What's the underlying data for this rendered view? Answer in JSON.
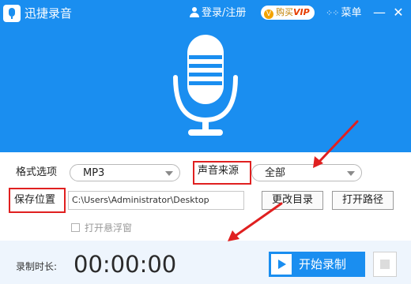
{
  "app": {
    "title": "迅捷录音",
    "login_label": "登录/注册",
    "vip_label_prefix": "购买",
    "vip_label_suffix": "VIP",
    "menu_label": "菜单",
    "minimize_glyph": "—",
    "close_glyph": "✕"
  },
  "settings": {
    "format_label": "格式选项",
    "format_value": "MP3",
    "source_label": "声音来源",
    "source_value": "全部",
    "save_location_label": "保存位置",
    "save_path": "C:\\Users\\Administrator\\Desktop",
    "change_dir_button": "更改目录",
    "open_path_button": "打开路径",
    "floating_window_label": "打开悬浮窗"
  },
  "footer": {
    "duration_label": "录制时长:",
    "duration_value": "00:00:00",
    "start_record_button": "开始录制"
  },
  "colors": {
    "brand_blue": "#1a8ef0",
    "highlight_red": "#e02020",
    "footer_bg": "#eef5fd"
  },
  "icons": {
    "app": "microphone-icon",
    "user": "user-icon",
    "vip": "crown-icon",
    "menu": "grid-menu-icon",
    "hero": "microphone-icon",
    "play": "play-icon",
    "stop": "stop-icon"
  }
}
